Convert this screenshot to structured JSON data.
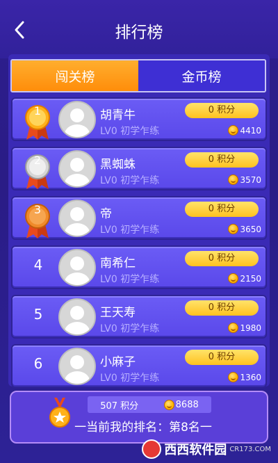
{
  "header": {
    "title": "排行榜"
  },
  "tabs": [
    {
      "label": "闯关榜",
      "active": true
    },
    {
      "label": "金币榜",
      "active": false
    }
  ],
  "rows": [
    {
      "rank": "1",
      "name": "胡青牛",
      "level": "LV0  初学乍练",
      "score": "0 积分",
      "coins": "4410",
      "medal": "gold"
    },
    {
      "rank": "2",
      "name": "黑蜘蛛",
      "level": "LV0  初学乍练",
      "score": "0 积分",
      "coins": "3570",
      "medal": "silver"
    },
    {
      "rank": "3",
      "name": "帝",
      "level": "LV0  初学乍练",
      "score": "0 积分",
      "coins": "3650",
      "medal": "bronze"
    },
    {
      "rank": "4",
      "name": "南希仁",
      "level": "LV0  初学乍练",
      "score": "0 积分",
      "coins": "2150"
    },
    {
      "rank": "5",
      "name": "王天寿",
      "level": "LV0  初学乍练",
      "score": "0 积分",
      "coins": "1980"
    },
    {
      "rank": "6",
      "name": "小麻子",
      "level": "LV0  初学乍练",
      "score": "0 积分",
      "coins": "1360"
    }
  ],
  "footer": {
    "my_score": "507 积分",
    "my_coins": "8688",
    "my_rank_text": "一当前我的排名：第8名一"
  },
  "watermark": {
    "brand": "西西软件园",
    "site": "CR173.COM"
  },
  "colors": {
    "accent_orange": "#ff9a1a",
    "tab_blue": "#3e2fd4",
    "row_purple": "#6352f0",
    "score_yellow": "#ffd23a"
  }
}
